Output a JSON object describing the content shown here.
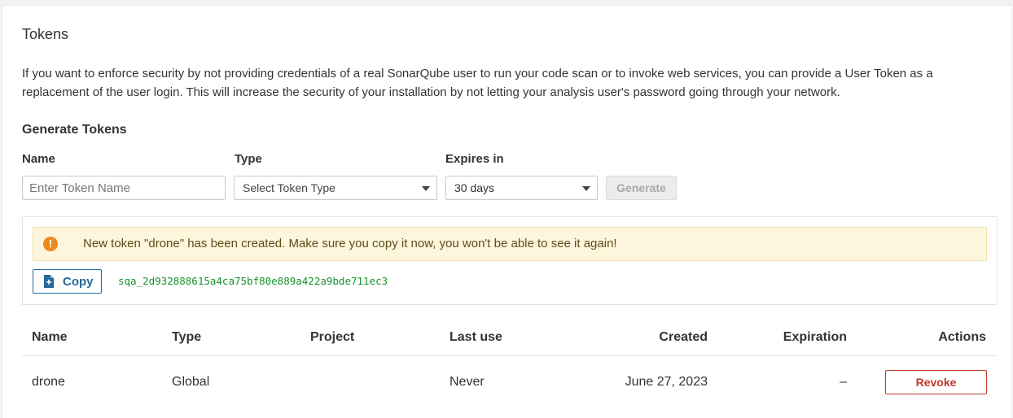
{
  "section": {
    "title": "Tokens",
    "description": "If you want to enforce security by not providing credentials of a real SonarQube user to run your code scan or to invoke web services, you can provide a User Token as a replacement of the user login. This will increase the security of your installation by not letting your analysis user's password going through your network."
  },
  "generate": {
    "title": "Generate Tokens",
    "name_label": "Name",
    "name_placeholder": "Enter Token Name",
    "type_label": "Type",
    "type_value": "Select Token Type",
    "expires_label": "Expires in",
    "expires_value": "30 days",
    "button_label": "Generate"
  },
  "notice": {
    "message": "New token \"drone\" has been created. Make sure you copy it now, you won't be able to see it again!",
    "copy_label": "Copy",
    "token_value": "sqa_2d932888615a4ca75bf80e889a422a9bde711ec3",
    "icon": "warning-icon",
    "icon_color": "#ec8a1c"
  },
  "table": {
    "headers": [
      "Name",
      "Type",
      "Project",
      "Last use",
      "Created",
      "Expiration",
      "Actions"
    ],
    "rows": [
      {
        "name": "drone",
        "type": "Global",
        "project": "",
        "last_use": "Never",
        "created": "June 27, 2023",
        "expiration": "–",
        "action": "Revoke"
      }
    ]
  }
}
